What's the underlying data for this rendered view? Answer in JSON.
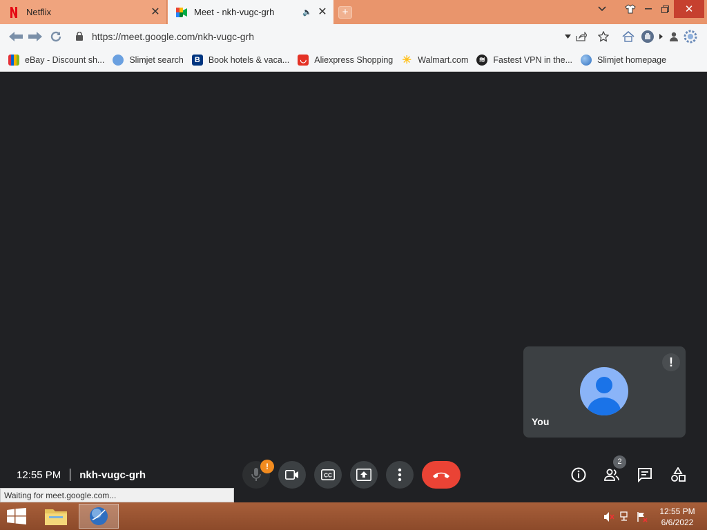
{
  "browser": {
    "tabs": [
      {
        "title": "Netflix",
        "icon": "netflix-icon",
        "active": false
      },
      {
        "title": "Meet - nkh-vugc-grh",
        "icon": "google-meet-icon",
        "active": true
      }
    ],
    "url": "https://meet.google.com/nkh-vugc-grh",
    "bookmarks": [
      {
        "label": "eBay - Discount sh...",
        "icon": "ebay-icon"
      },
      {
        "label": "Slimjet search",
        "icon": "slimjet-icon"
      },
      {
        "label": "Book hotels & vaca...",
        "icon": "booking-icon"
      },
      {
        "label": "Aliexpress Shopping",
        "icon": "aliexpress-icon"
      },
      {
        "label": "Walmart.com",
        "icon": "walmart-icon"
      },
      {
        "label": "Fastest VPN in the...",
        "icon": "vpn-icon"
      },
      {
        "label": "Slimjet homepage",
        "icon": "globe-icon"
      }
    ],
    "status_text": "Waiting for meet.google.com...",
    "colors": {
      "tabbar": "#e9956c",
      "toolbar": "#f5f6f7"
    }
  },
  "meet": {
    "self_tile_label": "You",
    "time": "12:55 PM",
    "meeting_code": "nkh-vugc-grh",
    "mic_alert": "!",
    "tile_alert": "!",
    "participant_count": "2",
    "colors": {
      "background": "#202124",
      "tile": "#3c4043",
      "end_call": "#ea4335",
      "avatar": "#8ab4f8",
      "avatar_figure": "#1a73e8",
      "warning": "#f28b1f"
    }
  },
  "taskbar": {
    "time": "12:55 PM",
    "date": "6/6/2022"
  }
}
